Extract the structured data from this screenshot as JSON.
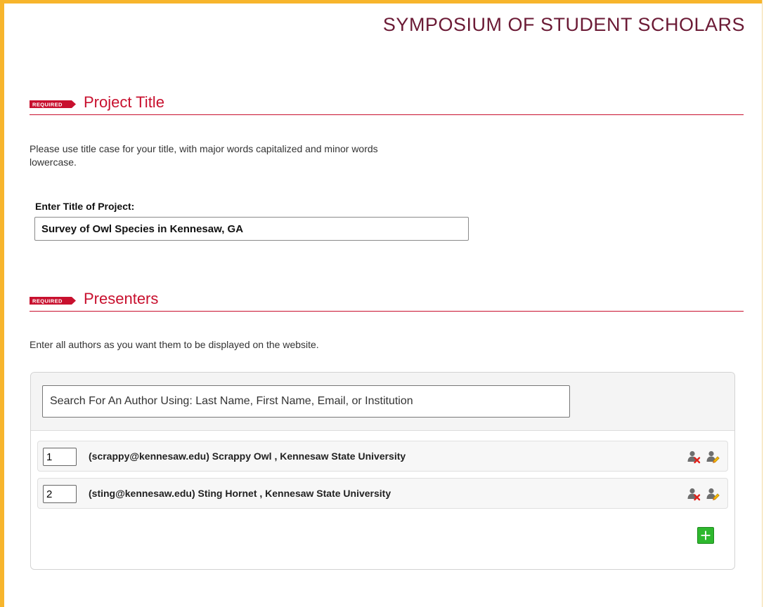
{
  "header": {
    "title": "SYMPOSIUM OF STUDENT SCHOLARS"
  },
  "badge": {
    "required_label": "REQUIRED"
  },
  "project_title_section": {
    "heading": "Project Title",
    "help_line1": "Please use title case for your title, with major words capitalized and minor words",
    "help_line2": "lowercase.",
    "field_label": "Enter Title of Project:",
    "field_value": "Survey of Owl Species in Kennesaw, GA"
  },
  "presenters_section": {
    "heading": "Presenters",
    "help": "Enter all authors as you want them to be displayed on the website.",
    "search_placeholder": "Search For An Author Using: Last Name, First Name, Email, or Institution",
    "authors": [
      {
        "order": "1",
        "text": "(scrappy@kennesaw.edu) Scrappy Owl , Kennesaw State University"
      },
      {
        "order": "2",
        "text": "(sting@kennesaw.edu) Sting Hornet , Kennesaw State University"
      }
    ]
  },
  "icons": {
    "required_badge": "required-badge-icon",
    "remove_author": "remove-author-icon",
    "edit_author": "edit-author-icon",
    "add_author": "add-author-icon"
  },
  "colors": {
    "frame": "#f7b52c",
    "site_title": "#6b1a35",
    "section_heading": "#c8102e",
    "badge": "#c8102e",
    "add_button": "#2eb82e"
  }
}
